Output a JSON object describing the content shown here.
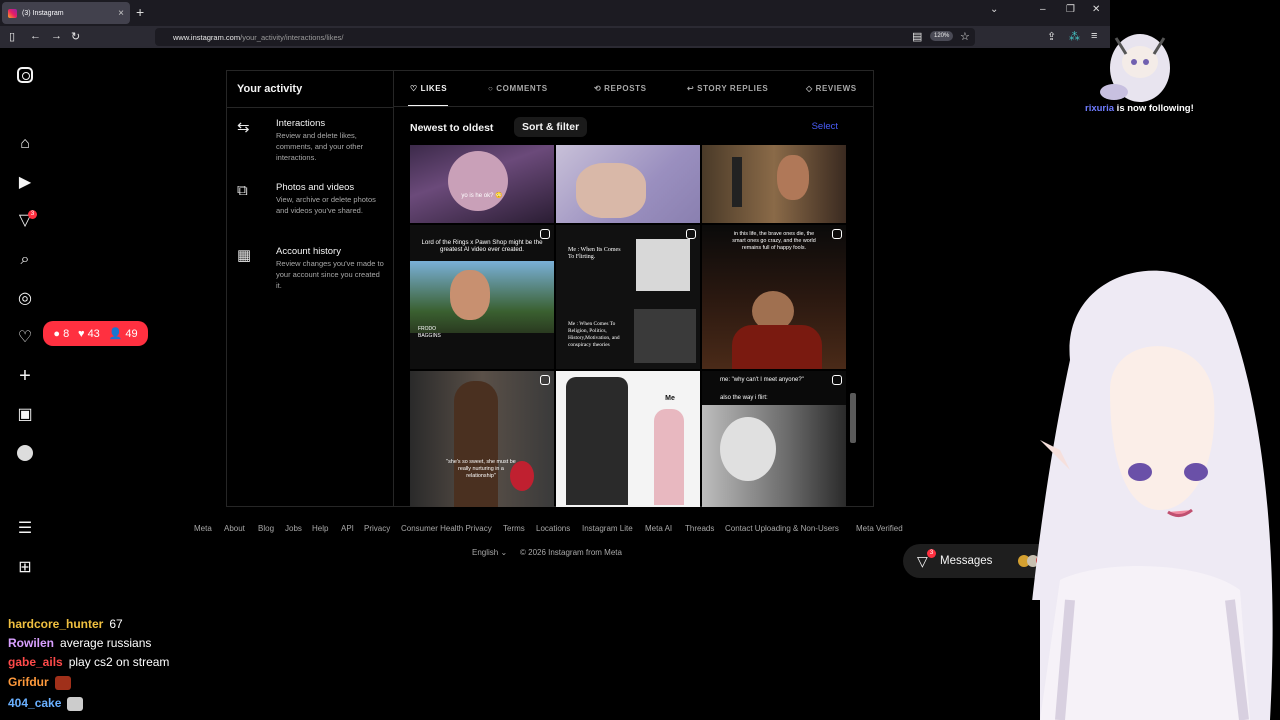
{
  "browser": {
    "tab_title": "(3) Instagram",
    "url_domain": "www.instagram.com",
    "url_path": "/your_activity/interactions/likes/",
    "zoom": "120%"
  },
  "sidebar": {
    "notifications_badge": "3",
    "pill": {
      "comments": "8",
      "likes": "43",
      "follows": "49"
    }
  },
  "activity": {
    "title": "Your activity",
    "items": [
      {
        "label": "Interactions",
        "desc": "Review and delete likes, comments, and your other interactions."
      },
      {
        "label": "Photos and videos",
        "desc": "View, archive or delete photos and videos you've shared."
      },
      {
        "label": "Account history",
        "desc": "Review changes you've made to your account since you created it."
      }
    ]
  },
  "tabs": [
    "LIKES",
    "COMMENTS",
    "REPOSTS",
    "STORY REPLIES",
    "REVIEWS"
  ],
  "sort": {
    "order": "Newest to oldest",
    "filter_label": "Sort & filter",
    "select_label": "Select"
  },
  "grid": {
    "captions": {
      "c1": "yo is he ok? 😳",
      "c4a": "Lord of the Rings x Pawn Shop might be the greatest AI video ever created.",
      "c4b": "FRODO BAGGINS",
      "c5a": "Me : When Its Comes To Flirting.",
      "c5b": "Me : When Comes To Religion, Politics, History,Motivation, and conspiracy theories",
      "c6": "in this life, the brave ones die, the smart ones go crazy, and the world remains full of happy fools.",
      "c7": "\"she's so sweet, she must be really nurturing in a relationship\"",
      "c8": "Me",
      "c9a": "me: \"why can't I meet anyone?\"",
      "c9b": "also the way i flirt:"
    }
  },
  "footer": {
    "links": [
      "Meta",
      "About",
      "Blog",
      "Jobs",
      "Help",
      "API",
      "Privacy",
      "Consumer Health Privacy",
      "Terms",
      "Locations",
      "Instagram Lite",
      "Meta AI",
      "Threads",
      "Contact Uploading & Non-Users",
      "Meta Verified"
    ],
    "language": "English",
    "copyright": "© 2026 Instagram from Meta"
  },
  "messages": {
    "label": "Messages",
    "badge": "3"
  },
  "stream": {
    "follow_name": "rixuria",
    "follow_text": " is now following!",
    "chat": [
      {
        "user": "hardcore_hunter",
        "msg": "67",
        "color": "#f0c040"
      },
      {
        "user": "Rowilen",
        "msg": "average russians",
        "color": "#d9a0ff"
      },
      {
        "user": "gabe_ails",
        "msg": "play cs2 on stream",
        "color": "#ff4a4a"
      },
      {
        "user": "Grifdur",
        "msg": "",
        "color": "#ff9a3c"
      },
      {
        "user": "404_cake",
        "msg": "",
        "color": "#6ab0ff"
      }
    ]
  }
}
